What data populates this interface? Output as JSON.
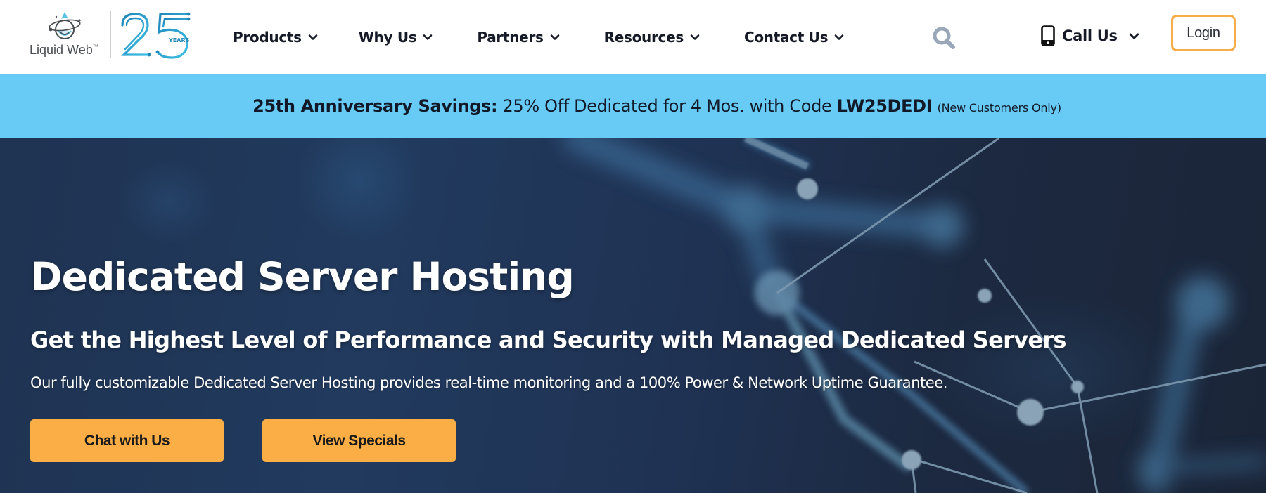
{
  "header": {
    "logo": {
      "brand_name": "Liquid Web",
      "trademark": "™",
      "anniversary_number": "25",
      "anniversary_word": "YEARS"
    },
    "nav": [
      {
        "label": "Products",
        "icon": "chevron-down-icon"
      },
      {
        "label": "Why Us",
        "icon": "chevron-down-icon"
      },
      {
        "label": "Partners",
        "icon": "chevron-down-icon"
      },
      {
        "label": "Resources",
        "icon": "chevron-down-icon"
      },
      {
        "label": "Contact Us",
        "icon": "chevron-down-icon"
      }
    ],
    "search_icon": "search-icon",
    "call_us": {
      "label": "Call Us",
      "icon": "mobile-phone-icon"
    },
    "login_label": "Login"
  },
  "promo": {
    "lead": "25th Anniversary Savings:",
    "body": "25% Off Dedicated for 4 Mos. with Code",
    "code": "LW25DEDI",
    "note": "(New Customers Only)"
  },
  "hero": {
    "title": "Dedicated Server Hosting",
    "subtitle": "Get the Highest Level of Performance and Security with Managed Dedicated Servers",
    "description": "Our fully customizable Dedicated Server Hosting provides real-time monitoring and a 100% Power & Network Uptime Guarantee.",
    "buttons": [
      {
        "label": "Chat with Us"
      },
      {
        "label": "View Specials"
      }
    ]
  },
  "colors": {
    "accent_orange": "#fbae46",
    "login_border": "#f6ad4a",
    "promo_bg": "#68cbf5",
    "hero_bg": "#1f3352",
    "logo_teal": "#1fa0c8"
  }
}
